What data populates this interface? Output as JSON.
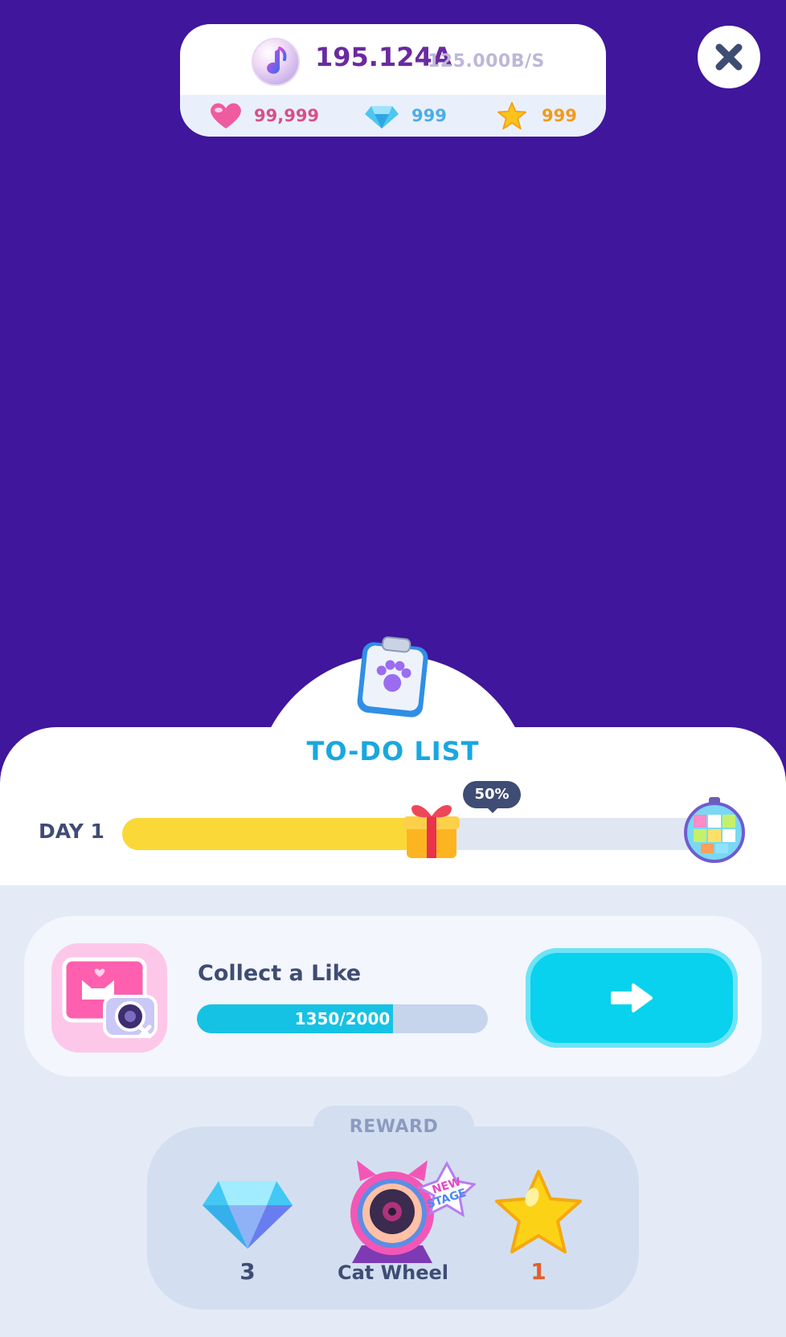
{
  "header": {
    "main_currency": "195.124A",
    "rate": "125.000B/S",
    "hearts": "99,999",
    "gems": "999",
    "stars": "999"
  },
  "todo": {
    "title": "TO-DO LIST",
    "day_label": "DAY 1",
    "progress_percent_label": "50%",
    "progress_fraction": 0.5
  },
  "task": {
    "label": "Collect a Like",
    "progress_text": "1350/2000",
    "progress_current": 1350,
    "progress_total": 2000
  },
  "reward": {
    "title": "REWARD",
    "items": [
      {
        "icon": "gem-icon",
        "caption": "3"
      },
      {
        "icon": "cat-wheel-icon",
        "caption": "Cat Wheel",
        "badge": "NEW STAGE"
      },
      {
        "icon": "star-icon",
        "caption": "1"
      }
    ]
  },
  "colors": {
    "background": "#3f169c",
    "accent_cyan": "#08d2ee",
    "progress_yellow": "#fad837",
    "heart_text": "#d94f8a",
    "gem_text": "#4aaee8",
    "star_text": "#f39a1c"
  }
}
